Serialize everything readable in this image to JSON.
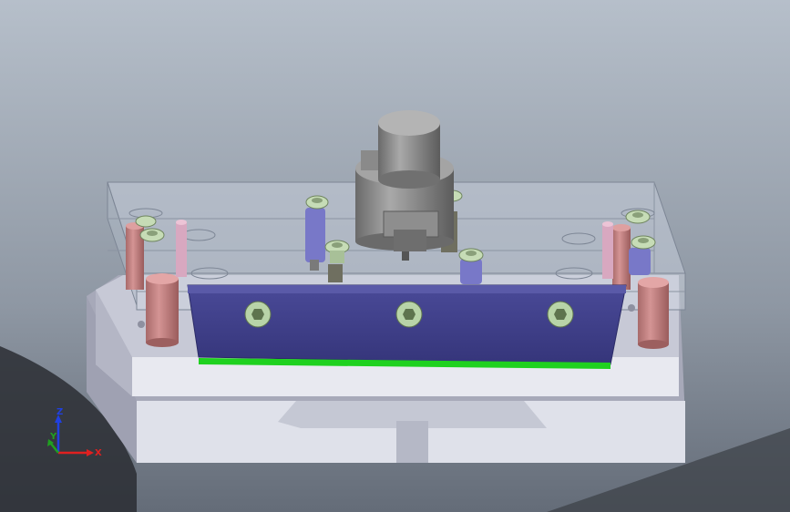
{
  "viewport": {
    "background_top": "#b3bcc7",
    "background_bottom": "#6e7783",
    "background_dark": "#1c1e22"
  },
  "model": {
    "base_plate_color": "#d9dbe6",
    "base_plate_shadow": "#a9abbb",
    "glass_plate_color": "#c8d0dc",
    "stripper_plate_color": "#3d3d86",
    "stripper_plate_edge": "#2b2b66",
    "punch_strip_color": "#1fd11f",
    "guide_post_color": "#c98686",
    "guide_post_dark": "#9c5f5f",
    "screw_head_color": "#b8d4a8",
    "spring_color": "#7474c4",
    "shank_color": "#8c8c8c",
    "shank_dark": "#5a5a5a"
  },
  "triad": {
    "label_z": "Z",
    "label_y": "Y",
    "label_x": "X",
    "color_z": "#2040e0",
    "color_y": "#20a020",
    "color_x": "#e02020"
  }
}
